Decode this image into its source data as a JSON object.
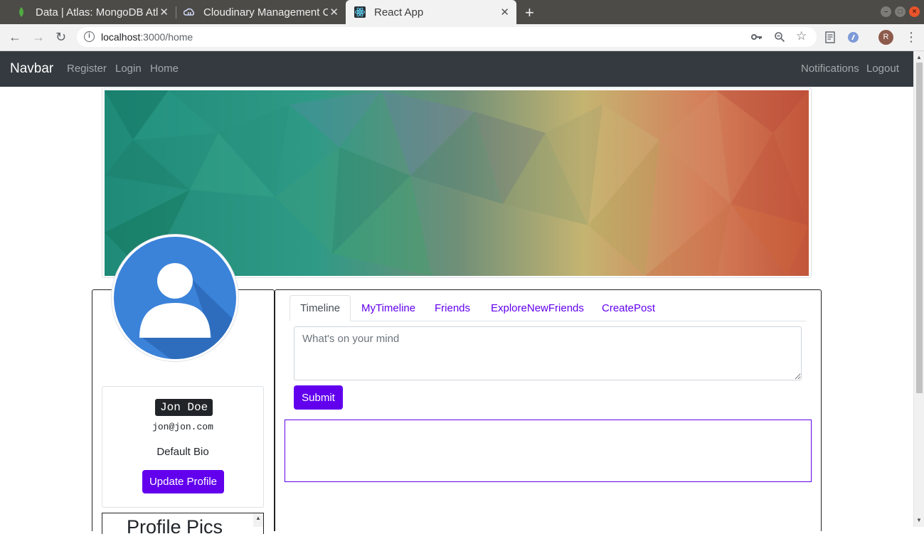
{
  "browser": {
    "tabs": [
      {
        "title": "Data | Atlas: MongoDB Atlas",
        "icon": "mongodb-leaf-icon",
        "active": false
      },
      {
        "title": "Cloudinary Management Console",
        "icon": "cloudinary-cloud-icon",
        "active": false
      },
      {
        "title": "React App",
        "icon": "react-atom-icon",
        "active": true
      }
    ],
    "new_tab_label": "+",
    "close_glyph": "✕",
    "url_host": "localhost",
    "url_path": ":3000/home",
    "profile_initial": "R"
  },
  "navbar": {
    "brand": "Navbar",
    "left_links": [
      "Register",
      "Login",
      "Home"
    ],
    "right_links": [
      "Notifications",
      "Logout"
    ],
    "background": "#343a40"
  },
  "profile": {
    "name": "Jon Doe",
    "email": "jon@jon.com",
    "bio": "Default Bio",
    "update_button": "Update Profile",
    "pics_title": "Profile Pics"
  },
  "content": {
    "tabs": [
      "Timeline",
      "MyTimeline",
      "Friends",
      "ExploreNewFriends",
      "CreatePost"
    ],
    "active_tab": "Timeline",
    "post_placeholder": "What's on your mind",
    "post_value": "",
    "submit_label": "Submit"
  },
  "colors": {
    "accent": "#6200ee",
    "avatar_blue": "#3b82d9"
  }
}
